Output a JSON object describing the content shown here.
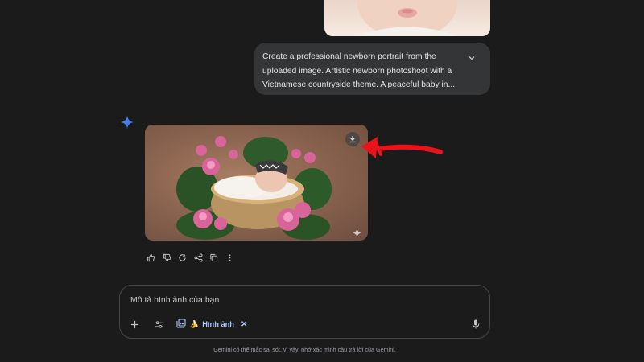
{
  "chat": {
    "prompt_text": "Create a professional newborn portrait from the uploaded image. Artistic newborn photoshoot with a Vietnamese countryside theme. A peaceful baby in...",
    "icons": {
      "expand": "chevron-down-icon",
      "assistant": "gemini-spark-icon",
      "download": "download-icon",
      "image_spark": "sparkle-icon"
    }
  },
  "actions": [
    {
      "name": "thumbs-up-icon"
    },
    {
      "name": "thumbs-down-icon"
    },
    {
      "name": "regenerate-icon"
    },
    {
      "name": "share-icon"
    },
    {
      "name": "copy-icon"
    },
    {
      "name": "more-icon"
    }
  ],
  "input": {
    "placeholder": "Mô tả hình ảnh của bạn",
    "chip_label": "Hình ảnh",
    "chip_emoji": "🍌",
    "chip_close": "✕"
  },
  "footer": {
    "disclaimer": "Gemini có thể mắc sai sót, vì vậy, nhớ xác minh câu trả lời của Gemini."
  },
  "colors": {
    "background": "#1b1b1c",
    "bubble": "#333537",
    "accent": "#a8c7fa",
    "arrow": "#e8131b"
  }
}
